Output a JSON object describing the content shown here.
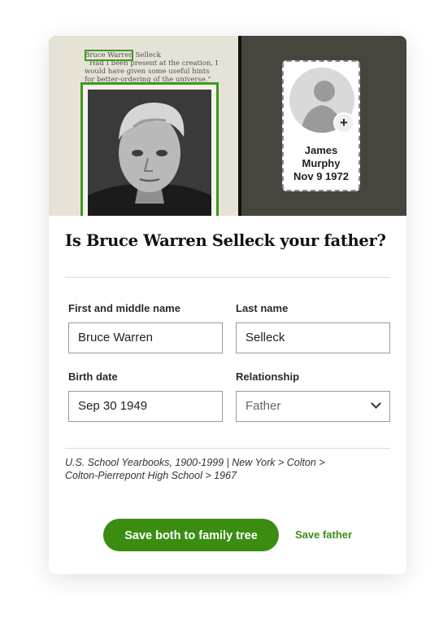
{
  "hero": {
    "scan_lines": [
      "Bruce Warren Selleck",
      "Had I been present at the creation, I",
      "would have given some useful hints",
      "for better-ordering of the universe.\""
    ],
    "person_card": {
      "name_line1": "James",
      "name_line2": "Murphy",
      "birth_date": "Nov 9 1972",
      "add_symbol": "+"
    }
  },
  "question": "Is Bruce Warren Selleck your father?",
  "form": {
    "first_middle_label": "First and middle name",
    "first_middle_value": "Bruce Warren",
    "last_name_label": "Last name",
    "last_name_value": "Selleck",
    "birth_date_label": "Birth date",
    "birth_date_value": "Sep 30 1949",
    "relationship_label": "Relationship",
    "relationship_value": "Father"
  },
  "source": {
    "line1": "U.S. School Yearbooks, 1900-1999  | New York > Colton >",
    "line2": "Colton-Pierrepont High School > 1967"
  },
  "actions": {
    "primary_label": "Save both to family tree",
    "secondary_label": "Save father"
  },
  "colors": {
    "accent": "#3a8d11",
    "highlight_box": "#3c9a1e",
    "dark_panel": "#48443e"
  }
}
